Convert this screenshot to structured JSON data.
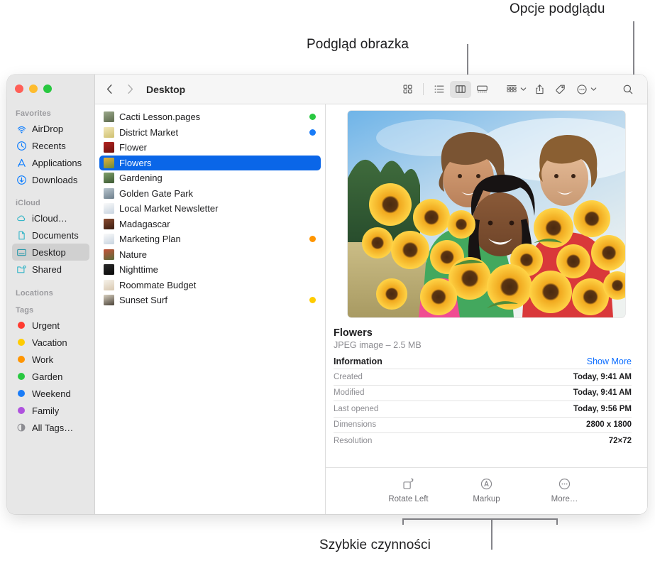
{
  "callouts": [
    {
      "id": "preview-options",
      "text": "Opcje podglądu"
    },
    {
      "id": "image-preview",
      "text": "Podgląd obrazka"
    },
    {
      "id": "quick-actions",
      "text": "Szybkie czynności"
    }
  ],
  "window": {
    "traffic_lights": [
      {
        "name": "close",
        "color": "#ff5f57"
      },
      {
        "name": "minimize",
        "color": "#febc2e"
      },
      {
        "name": "zoom",
        "color": "#28c840"
      }
    ]
  },
  "toolbar": {
    "back_label": "Back",
    "forward_label": "Forward",
    "path_title": "Desktop",
    "view_buttons": [
      {
        "icon": "icon-view-icon",
        "label": "Icon View",
        "active": false
      },
      {
        "icon": "list-view-icon",
        "label": "List View",
        "active": false
      },
      {
        "icon": "column-view-icon",
        "label": "Column View",
        "active": true
      },
      {
        "icon": "gallery-view-icon",
        "label": "Gallery View",
        "active": false
      }
    ],
    "action_buttons": [
      {
        "icon": "group-by-icon",
        "label": "Group",
        "caret": true
      },
      {
        "icon": "share-icon",
        "label": "Share",
        "caret": false
      },
      {
        "icon": "tag-icon",
        "label": "Tags",
        "caret": false
      },
      {
        "icon": "more-icon",
        "label": "More",
        "caret": true
      }
    ],
    "search_label": "Search"
  },
  "sidebar": {
    "sections": [
      {
        "header": "Favorites",
        "items": [
          {
            "label": "AirDrop",
            "icon": "airdrop-icon",
            "color": "#0a7cff",
            "selected": false
          },
          {
            "label": "Recents",
            "icon": "clock-icon",
            "color": "#0a7cff",
            "selected": false
          },
          {
            "label": "Applications",
            "icon": "applications-icon",
            "color": "#0a7cff",
            "selected": false
          },
          {
            "label": "Downloads",
            "icon": "downloads-icon",
            "color": "#0a7cff",
            "selected": false
          }
        ]
      },
      {
        "header": "iCloud",
        "items": [
          {
            "label": "iCloud…",
            "icon": "cloud-icon",
            "color": "#37b6c8",
            "selected": false
          },
          {
            "label": "Documents",
            "icon": "document-icon",
            "color": "#37b6c8",
            "selected": false
          },
          {
            "label": "Desktop",
            "icon": "desktop-icon",
            "color": "#37b6c8",
            "selected": true
          },
          {
            "label": "Shared",
            "icon": "shared-folder-icon",
            "color": "#37b6c8",
            "selected": false
          }
        ]
      },
      {
        "header": "Locations",
        "items": []
      },
      {
        "header": "Tags",
        "items": [
          {
            "label": "Urgent",
            "icon": "tag-dot-icon",
            "color": "#ff3b30",
            "selected": false
          },
          {
            "label": "Vacation",
            "icon": "tag-dot-icon",
            "color": "#ffcc00",
            "selected": false
          },
          {
            "label": "Work",
            "icon": "tag-dot-icon",
            "color": "#ff9500",
            "selected": false
          },
          {
            "label": "Garden",
            "icon": "tag-dot-icon",
            "color": "#28c840",
            "selected": false
          },
          {
            "label": "Weekend",
            "icon": "tag-dot-icon",
            "color": "#1a7cf7",
            "selected": false
          },
          {
            "label": "Family",
            "icon": "tag-dot-icon",
            "color": "#af52de",
            "selected": false
          },
          {
            "label": "All Tags…",
            "icon": "all-tags-icon",
            "color": "#8d8d92",
            "selected": false
          }
        ]
      }
    ]
  },
  "files": [
    {
      "name": "Cacti Lesson.pages",
      "tag": "#28c840",
      "selected": false,
      "thumb": [
        "#9aa88a",
        "#5e6b4e"
      ]
    },
    {
      "name": "District Market",
      "tag": "#1a7cf7",
      "selected": false,
      "thumb": [
        "#f2e8b8",
        "#cfc070"
      ]
    },
    {
      "name": "Flower",
      "tag": "",
      "selected": false,
      "thumb": [
        "#b3231f",
        "#6e1210"
      ]
    },
    {
      "name": "Flowers",
      "tag": "",
      "selected": true,
      "thumb": [
        "#e8b23a",
        "#6b8a3a"
      ]
    },
    {
      "name": "Gardening",
      "tag": "",
      "selected": false,
      "thumb": [
        "#7fa06a",
        "#3d5a33"
      ]
    },
    {
      "name": "Golden Gate Park",
      "tag": "",
      "selected": false,
      "thumb": [
        "#b9c6cf",
        "#6d7f8c"
      ]
    },
    {
      "name": "Local Market Newsletter",
      "tag": "",
      "selected": false,
      "thumb": [
        "#f4f4f4",
        "#c8d4e0"
      ]
    },
    {
      "name": "Madagascar",
      "tag": "",
      "selected": false,
      "thumb": [
        "#8a4a2e",
        "#3a1e12"
      ]
    },
    {
      "name": "Marketing Plan",
      "tag": "#ff9500",
      "selected": false,
      "thumb": [
        "#f4f4f4",
        "#c8d4e0"
      ]
    },
    {
      "name": "Nature",
      "tag": "",
      "selected": false,
      "thumb": [
        "#c4533a",
        "#5a6b3a"
      ]
    },
    {
      "name": "Nighttime",
      "tag": "",
      "selected": false,
      "thumb": [
        "#2a2a2a",
        "#0a0a0a"
      ]
    },
    {
      "name": "Roommate Budget",
      "tag": "",
      "selected": false,
      "thumb": [
        "#f0f0f0",
        "#d8c8b0"
      ]
    },
    {
      "name": "Sunset Surf",
      "tag": "#ffcc00",
      "selected": false,
      "thumb": [
        "#d8d0c0",
        "#4a4238"
      ]
    }
  ],
  "preview": {
    "image_alt": "flowers-preview-image",
    "title": "Flowers",
    "subtitle": "JPEG image – 2.5 MB",
    "section_title": "Information",
    "show_more_label": "Show More",
    "rows": [
      {
        "key": "Created",
        "value": "Today, 9:41 AM"
      },
      {
        "key": "Modified",
        "value": "Today, 9:41 AM"
      },
      {
        "key": "Last opened",
        "value": "Today, 9:56 PM"
      },
      {
        "key": "Dimensions",
        "value": "2800 x 1800"
      },
      {
        "key": "Resolution",
        "value": "72×72"
      }
    ]
  },
  "quick_actions": [
    {
      "label": "Rotate Left",
      "icon": "rotate-left-icon"
    },
    {
      "label": "Markup",
      "icon": "markup-icon"
    },
    {
      "label": "More…",
      "icon": "more-circle-icon"
    }
  ],
  "colors": {
    "accent": "#0a66e8",
    "link": "#0a6cff",
    "sidebar_bg": "#e7e7e7",
    "toolbar_bg": "#f6f6f6"
  }
}
